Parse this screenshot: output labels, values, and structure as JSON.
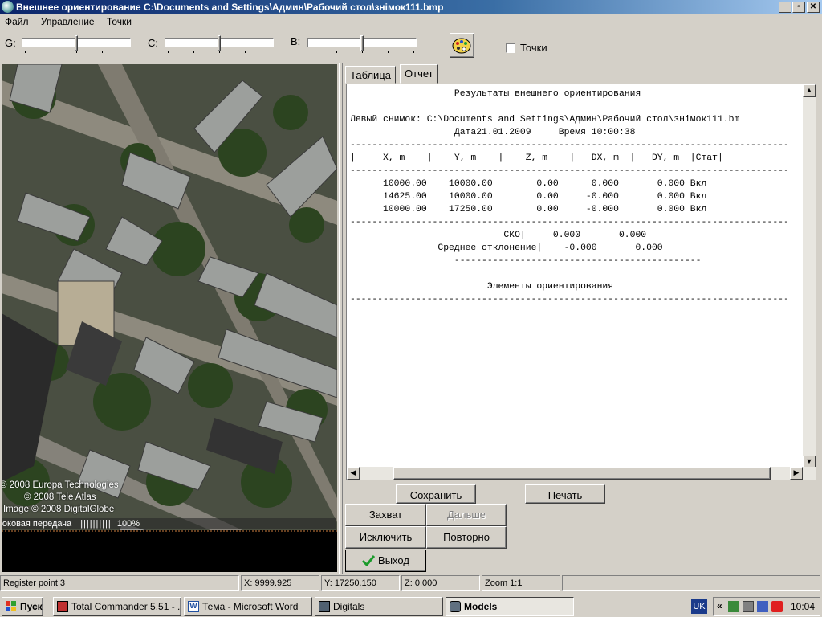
{
  "window": {
    "title": "Внешнее ориентирование C:\\Documents and Settings\\Админ\\Рабочий стол\\знімок111.bmp",
    "minimize": "_",
    "maximize": "▫",
    "close": "✕"
  },
  "menu": {
    "items": [
      "Файл",
      "Управление",
      "Точки"
    ]
  },
  "toolbar": {
    "g_label": "G:",
    "c_label": "C:",
    "b_label": "B:",
    "points_label": "Точки",
    "points_checked": false
  },
  "image_overlay": {
    "copyright1": "© 2008 Europa Technologies",
    "copyright2": "© 2008 Tele Atlas",
    "copyright3": "Image © 2008 DigitalGlobe",
    "progress_text": "токовая передача",
    "progress_value": "100%"
  },
  "tabs": [
    "Таблица",
    "Отчет"
  ],
  "active_tab": "Отчет",
  "report": {
    "title": "Результаты внешнего ориентирования",
    "left_image_line": "Левый снимок: C:\\Documents and Settings\\Админ\\Рабочий стол\\знімок111.bm",
    "date_line": "Дата21.01.2009     Время 10:00:38",
    "header": "|     X, m    |    Y, m    |    Z, m    |   DX, m  |   DY, m  |Стат|",
    "rows": [
      "10000.00    10000.00        0.00      0.000       0.000 Вкл",
      "14625.00    10000.00        0.00     -0.000       0.000 Вкл",
      "10000.00    17250.00        0.00     -0.000       0.000 Вкл"
    ],
    "sko_line": "СКО|     0.000       0.000",
    "mean_line": "Среднее отклонение|    -0.000       0.000",
    "elements_title": "Элементы ориентирования"
  },
  "buttons": {
    "save": "Сохранить",
    "print": "Печать",
    "capture": "Захват",
    "next": "Дальше",
    "exclude": "Исключить",
    "repeat": "Повторно",
    "exit": "Выход"
  },
  "statusbar": {
    "message": "Register point 3",
    "x": "X:   9999.925",
    "y": "Y:  17250.150",
    "z": "Z:    0.000",
    "zoom": "Zoom 1:1"
  },
  "taskbar": {
    "start": "Пуск",
    "tasks": [
      "Total Commander 5.51 - ...",
      "Тема - Microsoft Word",
      "Digitals",
      "Models"
    ],
    "active_task": "Models",
    "language": "UK",
    "clock": "10:04"
  },
  "colors": {
    "title_start": "#0a246a",
    "title_end": "#a6caf0",
    "face": "#d4d0c8",
    "exit_check": "#1a9a2a"
  }
}
